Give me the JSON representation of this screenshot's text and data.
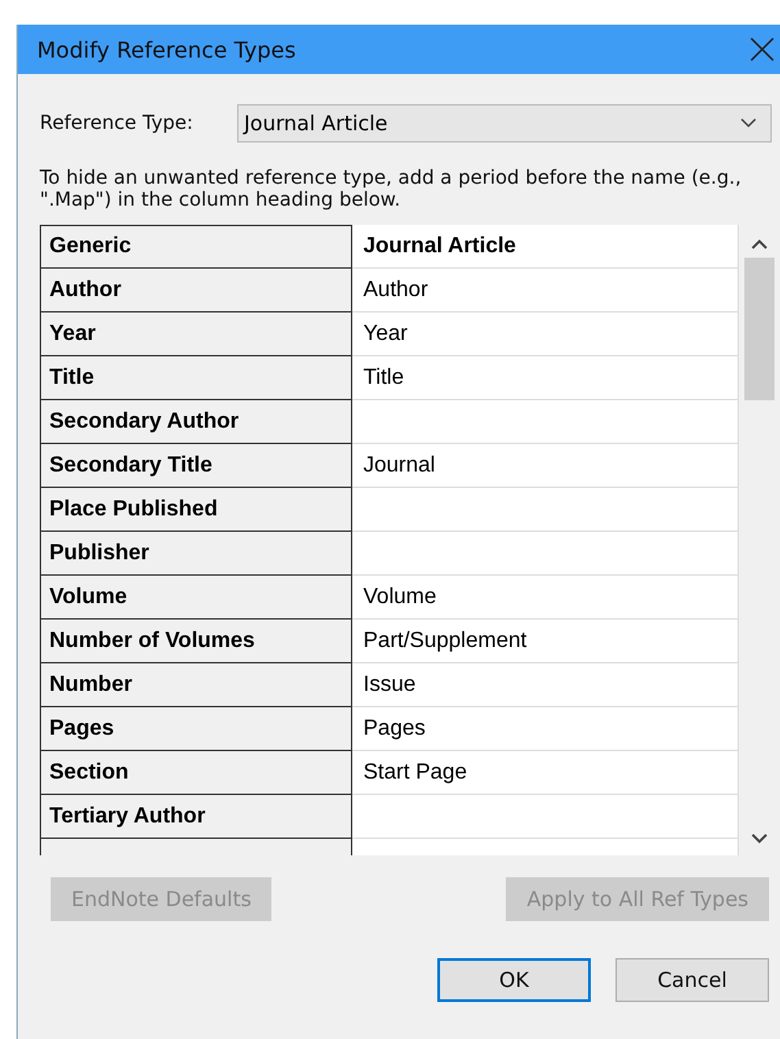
{
  "window": {
    "title": "Modify Reference Types"
  },
  "reference_type": {
    "label": "Reference Type:",
    "value": "Journal Article"
  },
  "instructions": "To hide an unwanted reference type, add a period before the name (e.g., \".Map\") in the column heading below.",
  "table": {
    "columns": [
      "Generic",
      "Journal Article"
    ],
    "rows": [
      [
        "Author",
        "Author"
      ],
      [
        "Year",
        "Year"
      ],
      [
        "Title",
        "Title"
      ],
      [
        "Secondary Author",
        ""
      ],
      [
        "Secondary Title",
        "Journal"
      ],
      [
        "Place Published",
        ""
      ],
      [
        "Publisher",
        ""
      ],
      [
        "Volume",
        "Volume"
      ],
      [
        "Number of Volumes",
        "Part/Supplement"
      ],
      [
        "Number",
        "Issue"
      ],
      [
        "Pages",
        "Pages"
      ],
      [
        "Section",
        "Start Page"
      ],
      [
        "Tertiary Author",
        ""
      ]
    ]
  },
  "buttons": [
    {
      "label": "EndNote Defaults",
      "disabled": true
    },
    {
      "label": "Apply to All Ref Types",
      "disabled": true
    },
    {
      "label": "OK",
      "disabled": false,
      "default": true
    },
    {
      "label": "Cancel",
      "disabled": false,
      "default": false
    }
  ]
}
